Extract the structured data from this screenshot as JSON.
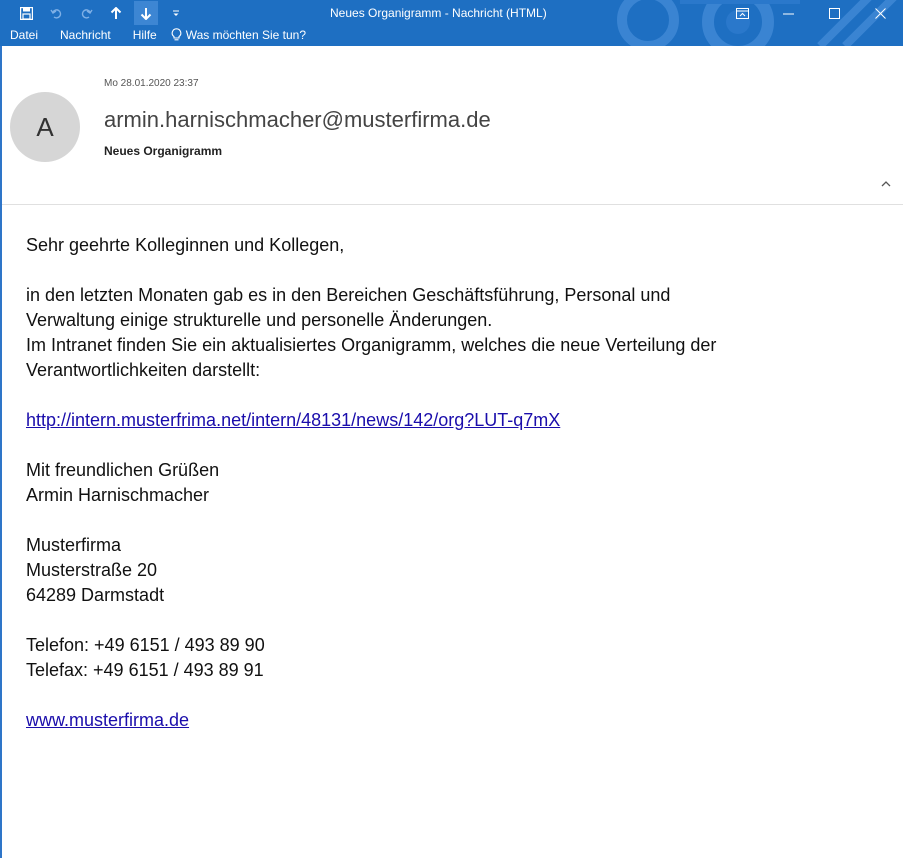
{
  "window": {
    "title": "Neues Organigramm  -  Nachricht (HTML)"
  },
  "qat": {
    "save_icon": "save-icon",
    "undo_icon": "undo-icon",
    "redo_icon": "redo-icon",
    "up_icon": "arrow-up-icon",
    "down_icon": "arrow-down-icon",
    "customize_icon": "customize-icon"
  },
  "menu": {
    "items": [
      "Datei",
      "Nachricht",
      "Hilfe"
    ],
    "tellme": "Was möchten Sie tun?"
  },
  "header": {
    "avatar_initial": "A",
    "date": "Mo 28.01.2020 23:37",
    "from": "armin.harnischmacher@musterfirma.de",
    "subject": "Neues Organigramm"
  },
  "body": {
    "greeting": "Sehr geehrte Kolleginnen und Kollegen,",
    "line1": "in den letzten Monaten gab es in den Bereichen Geschäftsführung, Personal und",
    "line2": "Verwaltung einige strukturelle und personelle Änderungen.",
    "line3": "Im Intranet finden Sie ein aktualisiertes Organigramm, welches die neue Verteilung der",
    "line4": "Verantwortlichkeiten darstellt:",
    "link": "http://intern.musterfrima.net/intern/48131/news/142/org?LUT-q7mX",
    "closing": "Mit freundlichen Grüßen",
    "sender_name": "Armin Harnischmacher",
    "company": "Musterfirma",
    "street": "Musterstraße 20",
    "city": "64289 Darmstadt",
    "phone": "Telefon: +49 6151 / 493 89 90",
    "fax": "Telefax: +49 6151 / 493 89 91",
    "website": "www.musterfirma.de"
  },
  "colors": {
    "titlebar": "#1e6fc2",
    "link": "#1a0dab"
  }
}
